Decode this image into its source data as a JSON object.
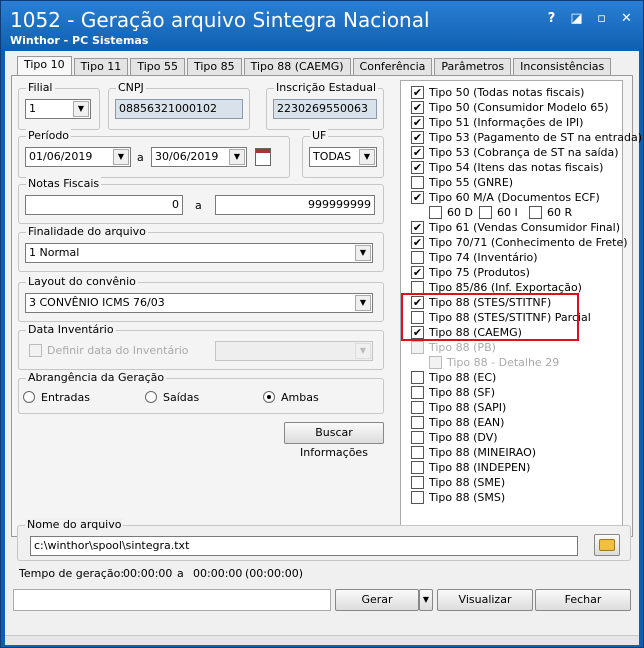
{
  "window": {
    "title": "1052 - Geração arquivo Sintegra Nacional",
    "subtitle": "Winthor - PC Sistemas"
  },
  "tabs": [
    "Tipo 10",
    "Tipo 11",
    "Tipo 55",
    "Tipo 85",
    "Tipo 88 (CAEMG)",
    "Conferência",
    "Parâmetros",
    "Inconsistências"
  ],
  "filial": {
    "label": "Filial",
    "value": "1"
  },
  "cnpj": {
    "label": "CNPJ",
    "value": "08856321000102"
  },
  "inscricao": {
    "label": "Inscrição Estadual",
    "value": "2230269550063"
  },
  "periodo": {
    "label": "Período",
    "inicio": "01/06/2019",
    "separador": "a",
    "fim": "30/06/2019"
  },
  "uf": {
    "label": "UF",
    "value": "TODAS"
  },
  "notas": {
    "label": "Notas Fiscais",
    "de": "0",
    "separador": "a",
    "ate": "999999999"
  },
  "finalidade": {
    "label": "Finalidade do arquivo",
    "value": "1 Normal"
  },
  "layout": {
    "label": "Layout do convênio",
    "value": "3 CONVÊNIO ICMS 76/03"
  },
  "inventario": {
    "label": "Data Inventário",
    "checkbox_label": "Definir data do Inventário",
    "value": ""
  },
  "abrangencia": {
    "label": "Abrangência da Geração",
    "options": [
      "Entradas",
      "Saídas",
      "Ambas"
    ],
    "selected": "Ambas"
  },
  "buscar_button": "Buscar Informações",
  "registros": [
    {
      "label": "Tipo 50 (Todas notas fiscais)",
      "checked": true,
      "disabled": false,
      "indent": 0
    },
    {
      "label": "Tipo 50 (Consumidor Modelo 65)",
      "checked": true,
      "disabled": false,
      "indent": 0
    },
    {
      "label": "Tipo 51 (Informações de IPI)",
      "checked": true,
      "disabled": false,
      "indent": 0
    },
    {
      "label": "Tipo 53 (Pagamento de ST na entrada)",
      "checked": true,
      "disabled": false,
      "indent": 0
    },
    {
      "label": "Tipo 53 (Cobrança de ST na saída)",
      "checked": true,
      "disabled": false,
      "indent": 0
    },
    {
      "label": "Tipo 54 (Itens das notas fiscais)",
      "checked": true,
      "disabled": false,
      "indent": 0
    },
    {
      "label": "Tipo 55 (GNRE)",
      "checked": false,
      "disabled": false,
      "indent": 0
    },
    {
      "label": "Tipo 60 M/A (Documentos ECF)",
      "checked": true,
      "disabled": false,
      "indent": 0
    },
    {
      "label": "Tipo 61 (Vendas Consumidor Final)",
      "checked": true,
      "disabled": false,
      "indent": 0
    },
    {
      "label": "Tipo 70/71 (Conhecimento de Frete)",
      "checked": true,
      "disabled": false,
      "indent": 0
    },
    {
      "label": "Tipo 74 (Inventário)",
      "checked": false,
      "disabled": false,
      "indent": 0
    },
    {
      "label": "Tipo 75 (Produtos)",
      "checked": true,
      "disabled": false,
      "indent": 0
    },
    {
      "label": "Tipo 85/86 (Inf. Exportação)",
      "checked": false,
      "disabled": false,
      "indent": 0
    },
    {
      "label": "Tipo 88 (STES/STITNF)",
      "checked": true,
      "disabled": false,
      "indent": 0
    },
    {
      "label": "Tipo 88 (STES/STITNF) Parcial",
      "checked": false,
      "disabled": false,
      "indent": 0
    },
    {
      "label": "Tipo 88 (CAEMG)",
      "checked": true,
      "disabled": false,
      "indent": 0
    },
    {
      "label": "Tipo 88 (PB)",
      "checked": false,
      "disabled": true,
      "indent": 0
    },
    {
      "label": "Tipo 88 - Detalhe 29",
      "checked": false,
      "disabled": true,
      "indent": 1
    },
    {
      "label": "Tipo 88 (EC)",
      "checked": false,
      "disabled": false,
      "indent": 0
    },
    {
      "label": "Tipo 88 (SF)",
      "checked": false,
      "disabled": false,
      "indent": 0
    },
    {
      "label": "Tipo 88 (SAPI)",
      "checked": false,
      "disabled": false,
      "indent": 0
    },
    {
      "label": "Tipo 88 (EAN)",
      "checked": false,
      "disabled": false,
      "indent": 0
    },
    {
      "label": "Tipo 88 (DV)",
      "checked": false,
      "disabled": false,
      "indent": 0
    },
    {
      "label": "Tipo 88 (MINEIRAO)",
      "checked": false,
      "disabled": false,
      "indent": 0
    },
    {
      "label": "Tipo 88 (INDEPEN)",
      "checked": false,
      "disabled": false,
      "indent": 0
    },
    {
      "label": "Tipo 88 (SME)",
      "checked": false,
      "disabled": false,
      "indent": 0
    },
    {
      "label": "Tipo 88 (SMS)",
      "checked": false,
      "disabled": false,
      "indent": 0
    }
  ],
  "sub60": [
    {
      "label": "60 D",
      "checked": false
    },
    {
      "label": "60 I",
      "checked": false
    },
    {
      "label": "60 R",
      "checked": false
    }
  ],
  "arquivo": {
    "label": "Nome do arquivo",
    "value": "c:\\winthor\\spool\\sintegra.txt"
  },
  "tempo": {
    "label": "Tempo de geração:",
    "inicio": "00:00:00",
    "separador": "a",
    "fim": "00:00:00",
    "total": "(00:00:00)"
  },
  "buttons": {
    "gerar": "Gerar",
    "visualizar": "Visualizar",
    "fechar": "Fechar"
  }
}
